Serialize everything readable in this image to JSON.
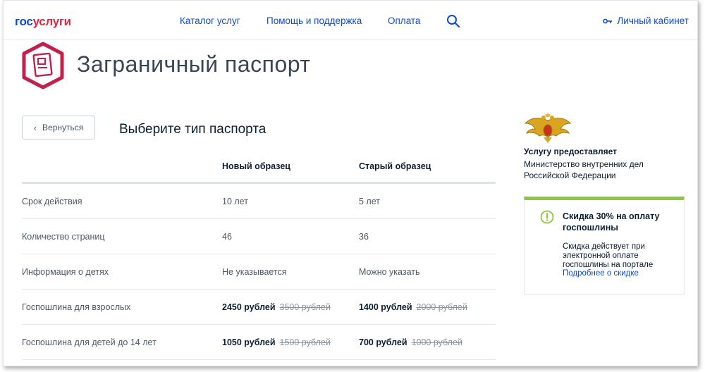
{
  "header": {
    "logo_part1": "гос",
    "logo_part2": "услуги",
    "nav": [
      "Каталог услуг",
      "Помощь и поддержка",
      "Оплата"
    ],
    "cabinet_label": "Личный кабинет"
  },
  "page": {
    "title": "Заграничный паспорт",
    "back_label": "Вернуться",
    "subtitle": "Выберите тип паспорта"
  },
  "table": {
    "headers": [
      "",
      "Новый образец",
      "Старый образец"
    ],
    "rows": [
      {
        "label": "Срок действия",
        "new": "10 лет",
        "old": "5 лет"
      },
      {
        "label": "Количество страниц",
        "new": "46",
        "old": "36"
      },
      {
        "label": "Информация о детях",
        "new": "Не указывается",
        "old": "Можно указать"
      },
      {
        "label": "Госпошлина для взрослых",
        "new_price": "2450 рублей",
        "new_old_price": "3500 рублей",
        "old_price": "1400 рублей",
        "old_old_price": "2000 рублей"
      },
      {
        "label": "Госпошлина для детей до 14 лет",
        "new_price": "1050 рублей",
        "new_old_price": "1500 рублей",
        "old_price": "700 рублей",
        "old_old_price": "1000 рублей"
      }
    ]
  },
  "provider": {
    "label": "Услугу предоставляет",
    "name": "Министерство внутренних дел Российской Федерации"
  },
  "discount": {
    "title": "Скидка 30% на оплату госпошлины",
    "text": "Скидка действует при электронной оплате госпошлины на портале",
    "link": "Подробнее о скидке"
  },
  "colors": {
    "brand_blue": "#0d4cd3",
    "brand_red": "#e5243f",
    "accent_green": "#8bc63e",
    "passport_icon": "#c41e4a"
  }
}
